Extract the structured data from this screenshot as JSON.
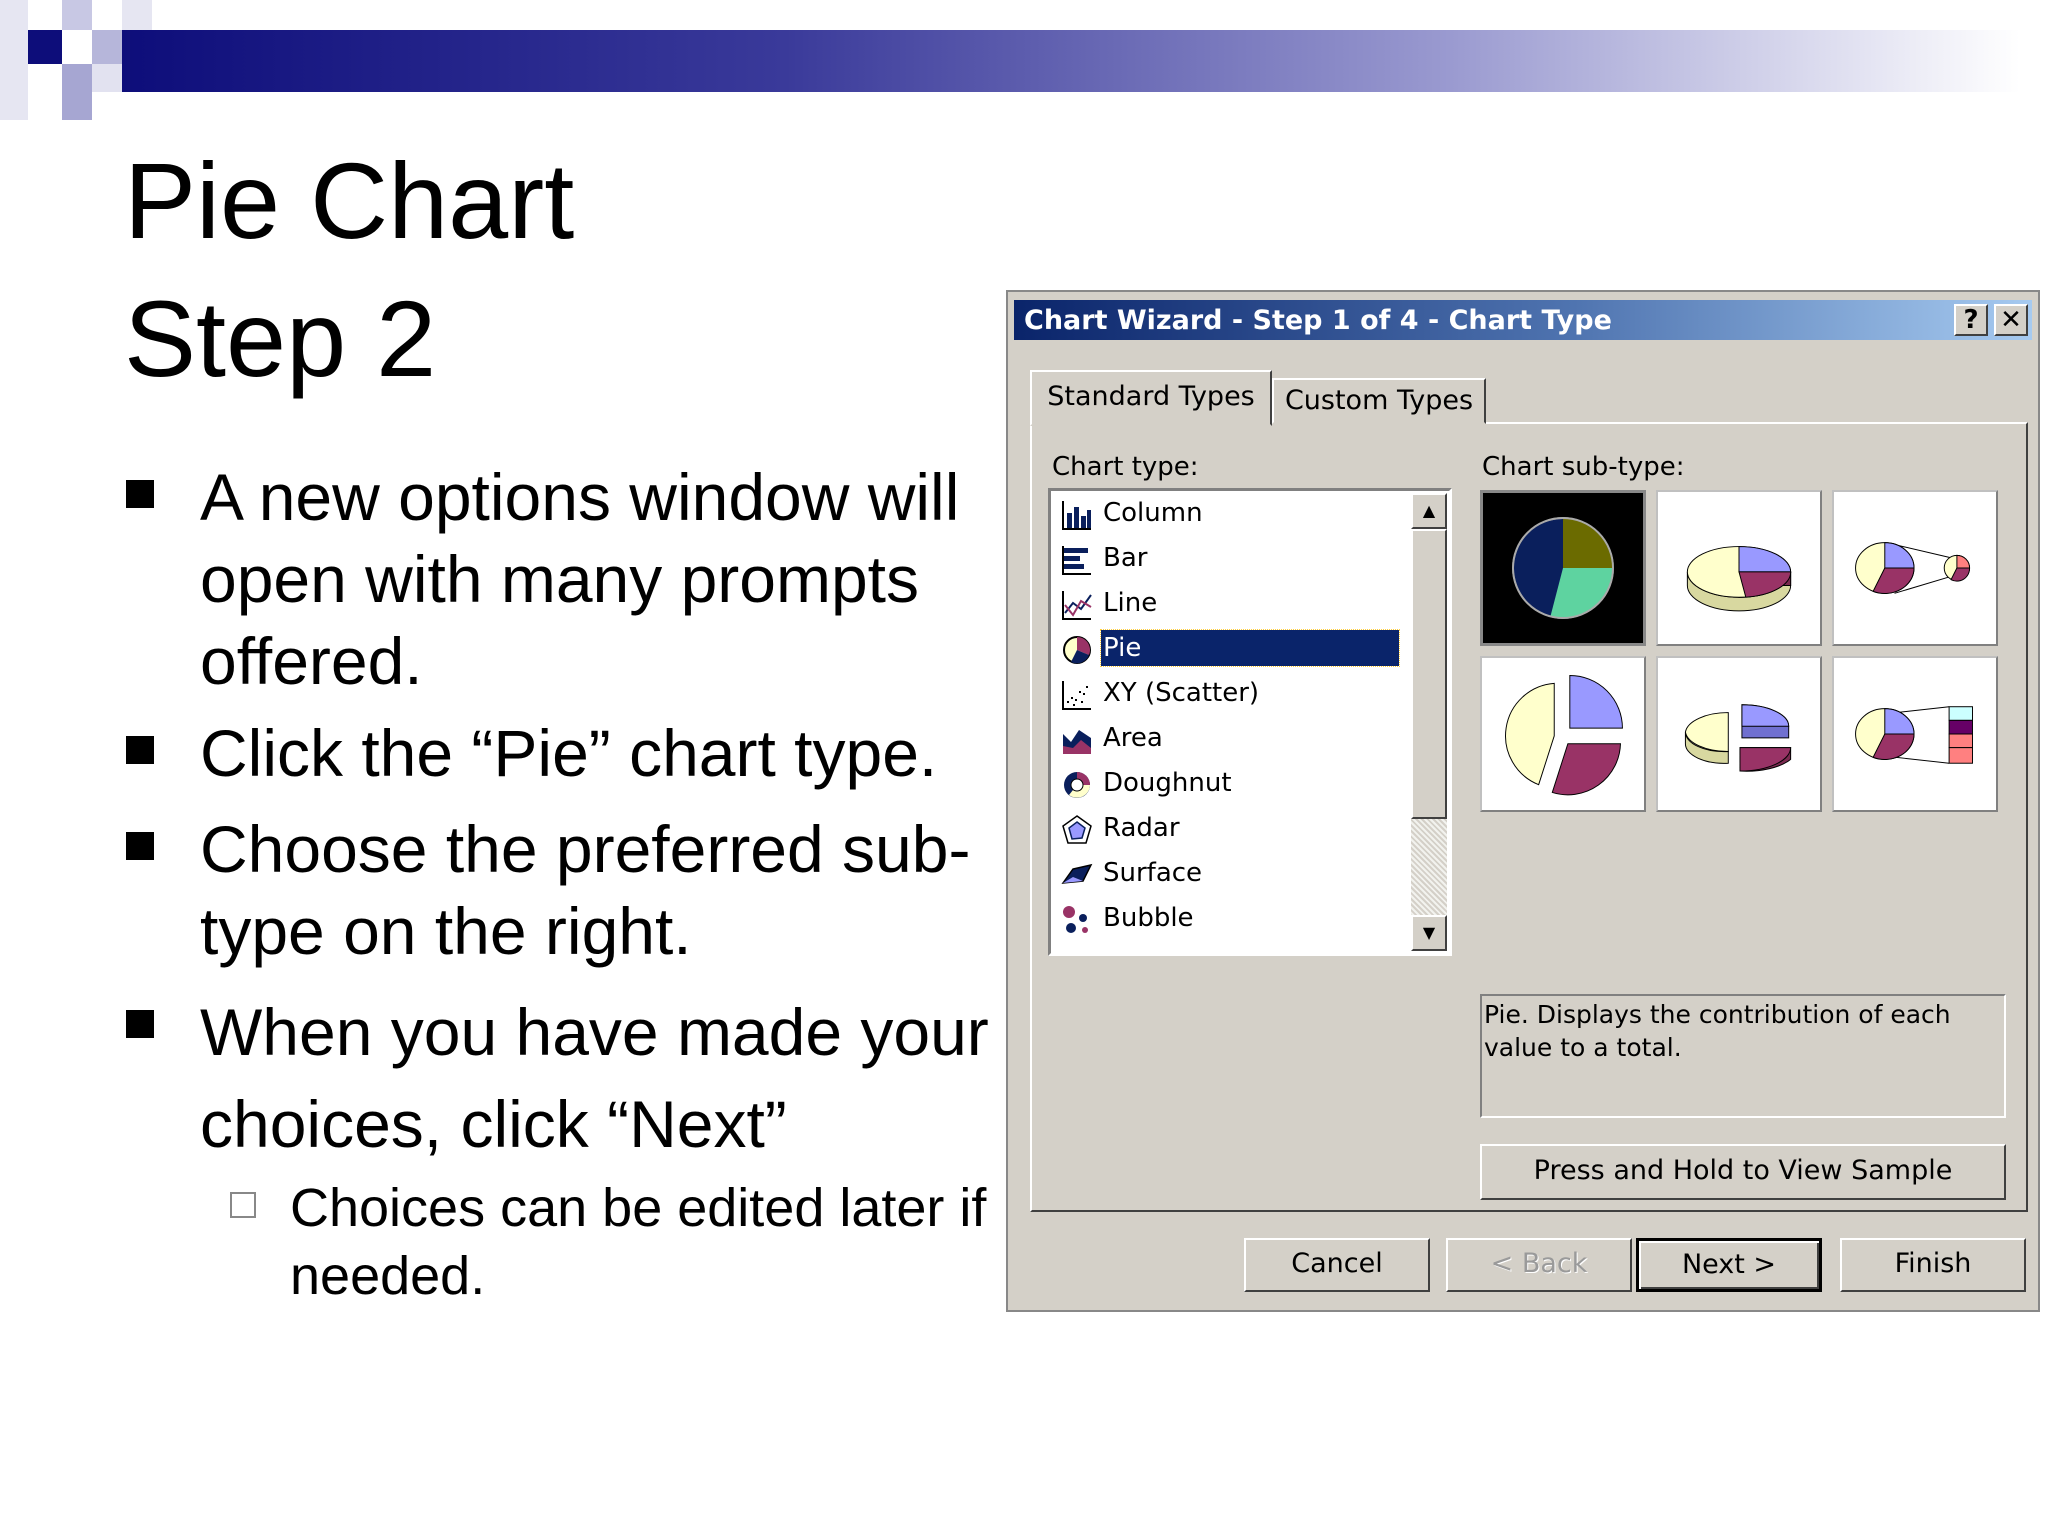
{
  "slide": {
    "title_line1": "Pie Chart",
    "title_line2": "Step 2",
    "bullets": [
      "A new options window will open with many prompts offered.",
      "Click the “Pie” chart type.",
      "Choose the preferred sub-type on the right.",
      "When you have made your choices, click “Next”"
    ],
    "sub_bullet": "Choices can be edited later if needed."
  },
  "dialog": {
    "title": "Chart Wizard - Step 1 of 4 - Chart Type",
    "help_label": "?",
    "close_label": "✕",
    "tabs": [
      "Standard Types",
      "Custom Types"
    ],
    "active_tab": "Standard Types",
    "chart_type_label": "Chart type:",
    "chart_subtype_label": "Chart sub-type:",
    "chart_types": [
      {
        "label": "Column",
        "icon": "column-chart-icon"
      },
      {
        "label": "Bar",
        "icon": "bar-chart-icon"
      },
      {
        "label": "Line",
        "icon": "line-chart-icon"
      },
      {
        "label": "Pie",
        "icon": "pie-chart-icon"
      },
      {
        "label": "XY (Scatter)",
        "icon": "scatter-chart-icon"
      },
      {
        "label": "Area",
        "icon": "area-chart-icon"
      },
      {
        "label": "Doughnut",
        "icon": "doughnut-chart-icon"
      },
      {
        "label": "Radar",
        "icon": "radar-chart-icon"
      },
      {
        "label": "Surface",
        "icon": "surface-chart-icon"
      },
      {
        "label": "Bubble",
        "icon": "bubble-chart-icon"
      }
    ],
    "selected_chart_type": "Pie",
    "subtypes": [
      "pie",
      "3d-pie",
      "pie-of-pie",
      "exploded-pie",
      "exploded-3d-pie",
      "bar-of-pie"
    ],
    "selected_subtype_index": 0,
    "description": "Pie. Displays the contribution of each value to a total.",
    "press_hold_label": "Press and Hold to View Sample",
    "buttons": {
      "cancel": "Cancel",
      "back": "< Back",
      "next": "Next >",
      "finish": "Finish"
    },
    "colors": {
      "selection": "#0a246a",
      "dialog_bg": "#d4d0c8",
      "pie_olive": "#6b6b00",
      "pie_teal": "#5ed3a0",
      "pie_navy": "#0a1f5c",
      "pie_lavender": "#9999ff",
      "pie_plum": "#993366",
      "pie_cream": "#ffffcc"
    }
  }
}
